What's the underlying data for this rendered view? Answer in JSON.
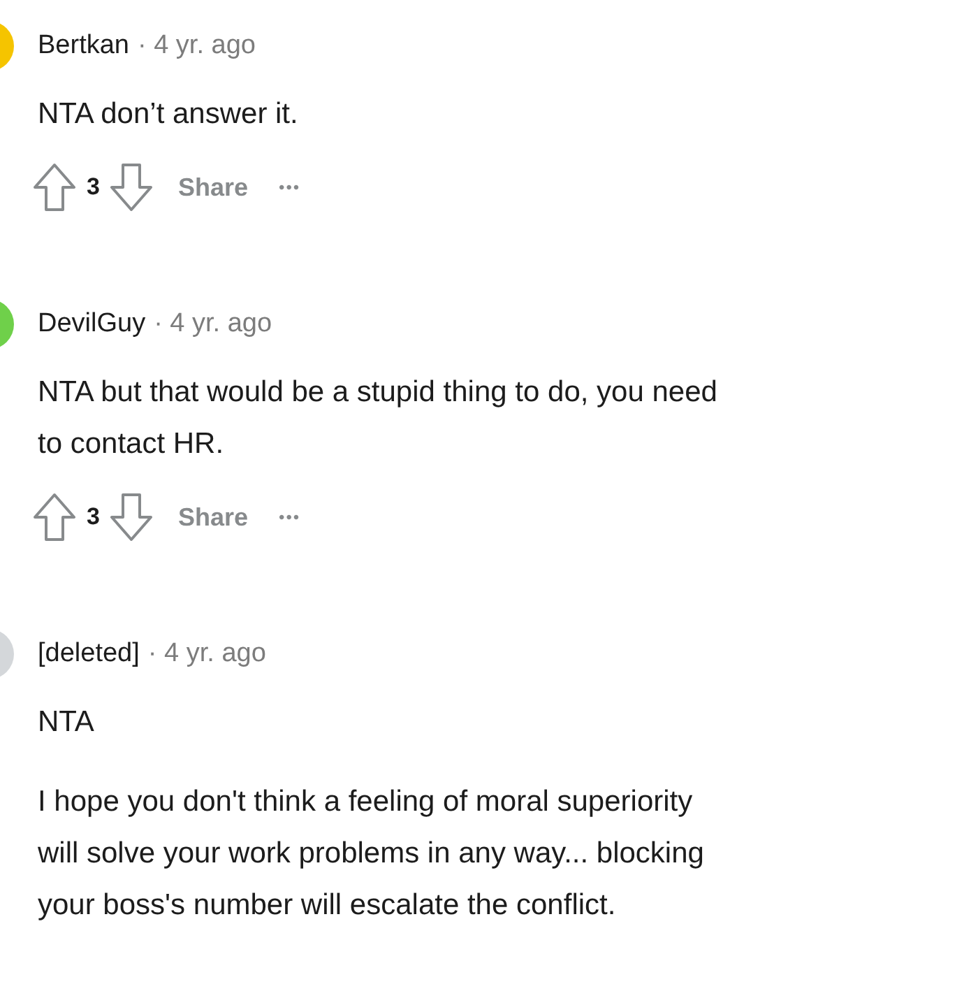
{
  "comments": [
    {
      "author": "Bertkan",
      "time": "· 4 yr. ago",
      "color": "#f5c400",
      "paragraphs": [
        [
          "NTA don’t answer it."
        ]
      ],
      "actions": {
        "score": "3",
        "share": "Share",
        "more": "•••"
      }
    },
    {
      "author": "DevilGuy",
      "time": "· 4 yr. ago",
      "color": "#6fd04a",
      "paragraphs": [
        [
          "NTA but that would be a stupid thing to do, you need",
          "to contact HR."
        ]
      ],
      "actions": {
        "score": "3",
        "share": "Share",
        "more": "•••"
      }
    },
    {
      "author": "[deleted]",
      "time": "· 4 yr. ago",
      "color": "#d4d7da",
      "paragraphs": [
        [
          "NTA"
        ],
        [
          "I hope you don't think a feeling of moral superiority",
          "will solve your work problems in any way... blocking",
          "your boss's number will escalate the conflict."
        ]
      ]
    }
  ]
}
